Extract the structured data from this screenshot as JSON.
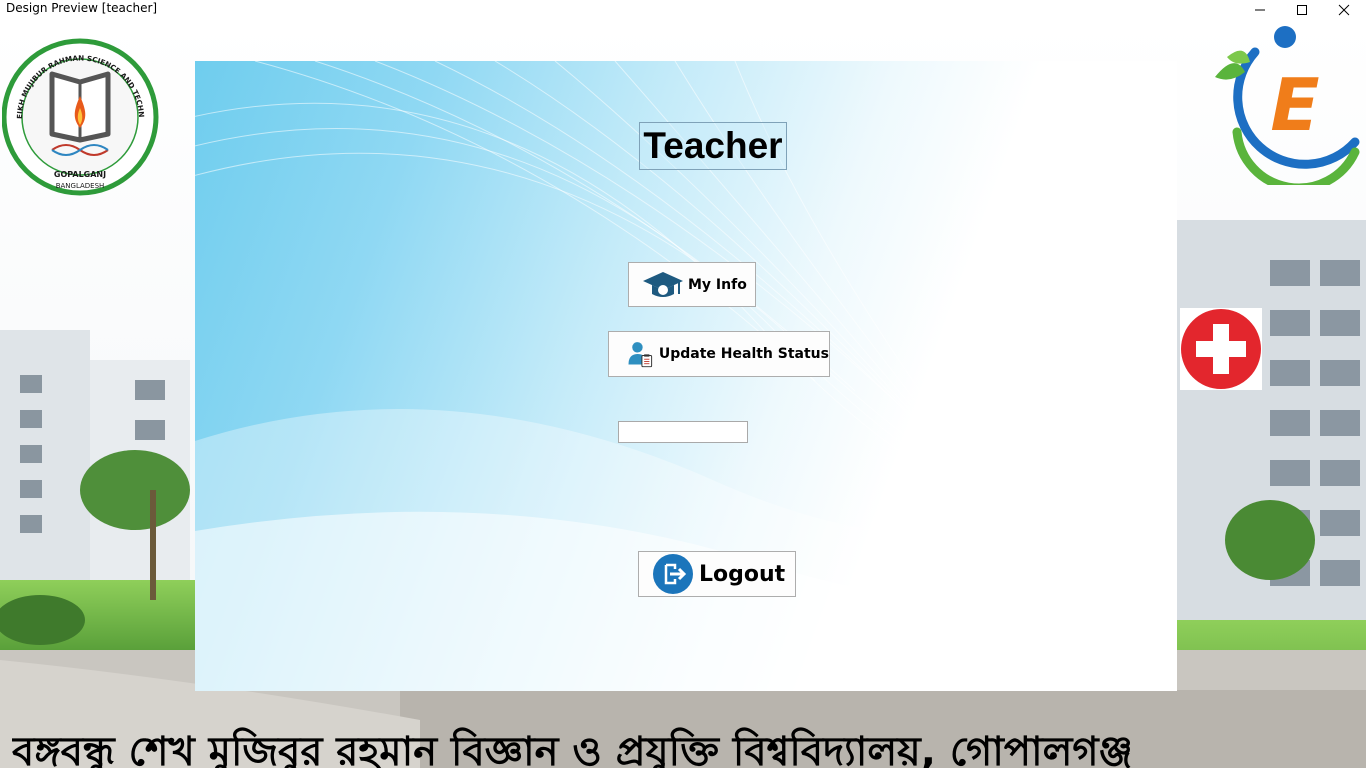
{
  "window": {
    "title": "Design Preview [teacher]"
  },
  "panel": {
    "heading": "Teacher"
  },
  "buttons": {
    "my_info": "My Info",
    "update_health": "Update Health Status",
    "logout": "Logout"
  },
  "field": {
    "value": ""
  },
  "logos": {
    "university_seal_text": "BANGABANDHU SHEIKH MUJIBUR RAHMAN SCIENCE AND TECHNOLOGY UNIVERSITY",
    "university_seal_city": "GOPALGANJ",
    "university_seal_country": "BANGLADESH",
    "brand_letter": "E"
  },
  "footer": {
    "text": "বঙ্গবন্ধু শেখ মুজিবুর রহমান বিজ্ঞান ও প্রযুক্তি বিশ্ববিদ্যালয়, গোপালগঞ্জ"
  },
  "colors": {
    "seal_green": "#2e9b3a",
    "brand_orange": "#f07d1a",
    "brand_blue": "#1d6fc3",
    "health_red": "#e3262d"
  },
  "icons": {
    "my_info": "graduation-cap-icon",
    "update_health": "user-clipboard-icon",
    "logout": "logout-icon",
    "health": "medical-cross-icon"
  }
}
